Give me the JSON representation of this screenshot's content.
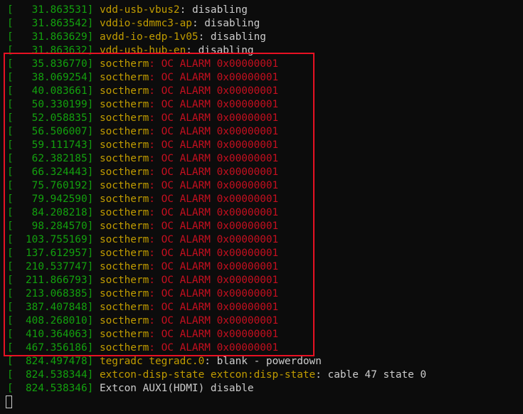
{
  "colors": {
    "background": "#0c0c0c",
    "timestamp": "#13a10e",
    "device": "#c19c00",
    "message": "#cccccc",
    "alarm": "#c50f1f",
    "highlight_box": "#e81123"
  },
  "lines": [
    {
      "ts": "[   31.863531] ",
      "dev": "vdd-usb-vbus2",
      "sep": ": ",
      "msg": "disabling",
      "kind": "normal"
    },
    {
      "ts": "[   31.863542] ",
      "dev": "vddio-sdmmc3-ap",
      "sep": ": ",
      "msg": "disabling",
      "kind": "normal"
    },
    {
      "ts": "[   31.863629] ",
      "dev": "avdd-io-edp-1v05",
      "sep": ": ",
      "msg": "disabling",
      "kind": "normal"
    },
    {
      "ts": "[   31.863632] ",
      "dev": "vdd-usb-hub-en",
      "sep": ": ",
      "msg": "disabling",
      "kind": "normal"
    },
    {
      "ts": "[   35.836770] ",
      "dev": "soctherm",
      "sep": ": ",
      "msg": "OC ALARM 0x00000001",
      "kind": "alarm"
    },
    {
      "ts": "[   38.069254] ",
      "dev": "soctherm",
      "sep": ": ",
      "msg": "OC ALARM 0x00000001",
      "kind": "alarm"
    },
    {
      "ts": "[   40.083661] ",
      "dev": "soctherm",
      "sep": ": ",
      "msg": "OC ALARM 0x00000001",
      "kind": "alarm"
    },
    {
      "ts": "[   50.330199] ",
      "dev": "soctherm",
      "sep": ": ",
      "msg": "OC ALARM 0x00000001",
      "kind": "alarm"
    },
    {
      "ts": "[   52.058835] ",
      "dev": "soctherm",
      "sep": ": ",
      "msg": "OC ALARM 0x00000001",
      "kind": "alarm"
    },
    {
      "ts": "[   56.506007] ",
      "dev": "soctherm",
      "sep": ": ",
      "msg": "OC ALARM 0x00000001",
      "kind": "alarm"
    },
    {
      "ts": "[   59.111743] ",
      "dev": "soctherm",
      "sep": ": ",
      "msg": "OC ALARM 0x00000001",
      "kind": "alarm"
    },
    {
      "ts": "[   62.382185] ",
      "dev": "soctherm",
      "sep": ": ",
      "msg": "OC ALARM 0x00000001",
      "kind": "alarm"
    },
    {
      "ts": "[   66.324443] ",
      "dev": "soctherm",
      "sep": ": ",
      "msg": "OC ALARM 0x00000001",
      "kind": "alarm"
    },
    {
      "ts": "[   75.760192] ",
      "dev": "soctherm",
      "sep": ": ",
      "msg": "OC ALARM 0x00000001",
      "kind": "alarm"
    },
    {
      "ts": "[   79.942590] ",
      "dev": "soctherm",
      "sep": ": ",
      "msg": "OC ALARM 0x00000001",
      "kind": "alarm"
    },
    {
      "ts": "[   84.208218] ",
      "dev": "soctherm",
      "sep": ": ",
      "msg": "OC ALARM 0x00000001",
      "kind": "alarm"
    },
    {
      "ts": "[   98.284570] ",
      "dev": "soctherm",
      "sep": ": ",
      "msg": "OC ALARM 0x00000001",
      "kind": "alarm"
    },
    {
      "ts": "[  103.755169] ",
      "dev": "soctherm",
      "sep": ": ",
      "msg": "OC ALARM 0x00000001",
      "kind": "alarm"
    },
    {
      "ts": "[  137.612957] ",
      "dev": "soctherm",
      "sep": ": ",
      "msg": "OC ALARM 0x00000001",
      "kind": "alarm"
    },
    {
      "ts": "[  210.537747] ",
      "dev": "soctherm",
      "sep": ": ",
      "msg": "OC ALARM 0x00000001",
      "kind": "alarm"
    },
    {
      "ts": "[  211.866793] ",
      "dev": "soctherm",
      "sep": ": ",
      "msg": "OC ALARM 0x00000001",
      "kind": "alarm"
    },
    {
      "ts": "[  213.068385] ",
      "dev": "soctherm",
      "sep": ": ",
      "msg": "OC ALARM 0x00000001",
      "kind": "alarm"
    },
    {
      "ts": "[  387.407848] ",
      "dev": "soctherm",
      "sep": ": ",
      "msg": "OC ALARM 0x00000001",
      "kind": "alarm"
    },
    {
      "ts": "[  408.268010] ",
      "dev": "soctherm",
      "sep": ": ",
      "msg": "OC ALARM 0x00000001",
      "kind": "alarm"
    },
    {
      "ts": "[  410.364063] ",
      "dev": "soctherm",
      "sep": ": ",
      "msg": "OC ALARM 0x00000001",
      "kind": "alarm"
    },
    {
      "ts": "[  467.356186] ",
      "dev": "soctherm",
      "sep": ": ",
      "msg": "OC ALARM 0x00000001",
      "kind": "alarm"
    },
    {
      "ts": "[  824.497478] ",
      "dev": "tegradc tegradc.0",
      "sep": ": ",
      "msg": "blank - powerdown",
      "kind": "normal"
    },
    {
      "ts": "[  824.538344] ",
      "dev": "extcon-disp-state extcon:disp-state",
      "sep": ": ",
      "msg": "cable 47 state 0",
      "kind": "normal"
    },
    {
      "ts": "[  824.538346] ",
      "dev": "",
      "sep": "",
      "msg": "Extcon AUX1(HDMI) disable",
      "kind": "normal"
    }
  ]
}
